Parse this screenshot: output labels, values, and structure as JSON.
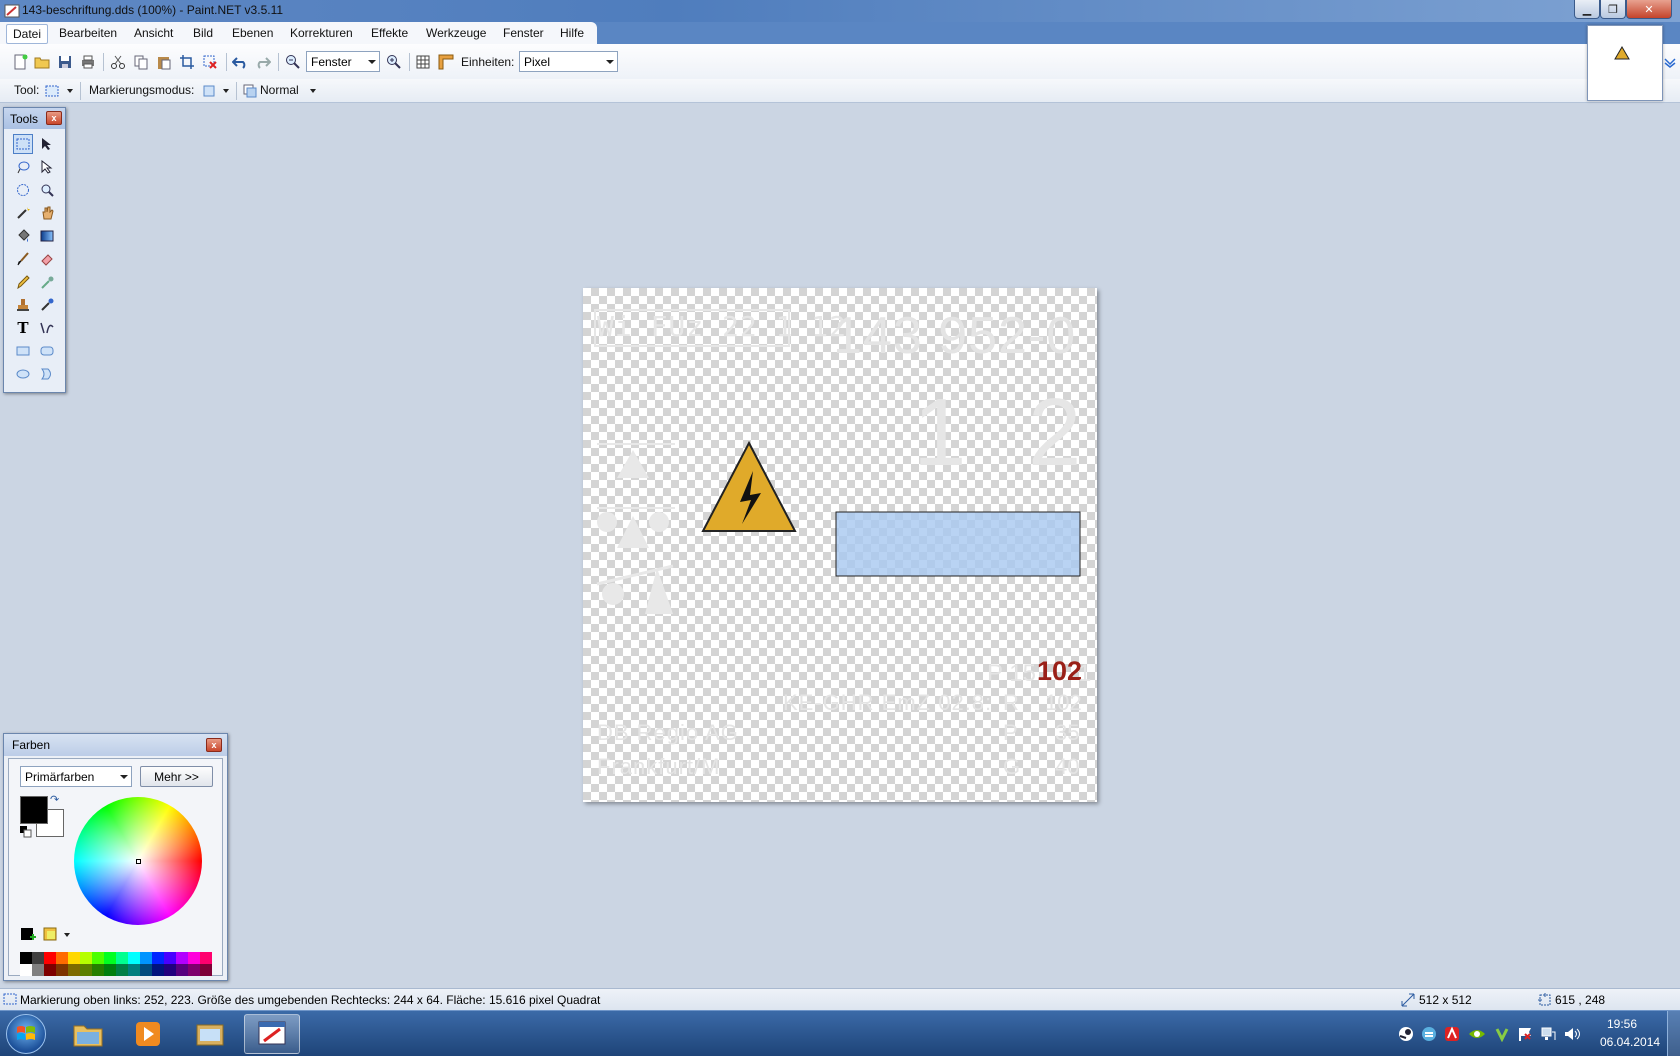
{
  "window": {
    "title": "143-beschriftung.dds (100%) - Paint.NET v3.5.11",
    "buttons": {
      "minimize": "▁",
      "maximize": "❐",
      "close": "✕"
    }
  },
  "menu": {
    "items": [
      "Datei",
      "Bearbeiten",
      "Ansicht",
      "Bild",
      "Ebenen",
      "Korrekturen",
      "Effekte",
      "Werkzeuge",
      "Fenster",
      "Hilfe"
    ]
  },
  "toolbar": {
    "zoom_value": "Fenster",
    "units_label": "Einheiten:",
    "units_value": "Pixel"
  },
  "toolbar2": {
    "tool_label": "Tool:",
    "selection_mode_label": "Markierungsmodus:",
    "blend_mode": "Normal"
  },
  "tools_window": {
    "title": "Tools",
    "close": "x"
  },
  "colors_window": {
    "title": "Farben",
    "close": "x",
    "palette_select": "Primärfarben",
    "more_button": "Mehr >>",
    "primary_color": "#000000",
    "secondary_color": "#ffffff",
    "palette_colors": [
      "#000000",
      "#404040",
      "#ff0000",
      "#ff6a00",
      "#ffd800",
      "#b6ff00",
      "#4cff00",
      "#00ff21",
      "#00ff90",
      "#00ffff",
      "#0094ff",
      "#0026ff",
      "#4800ff",
      "#b200ff",
      "#ff00dc",
      "#ff006e"
    ],
    "palette_colors_dark": [
      "#ffffff",
      "#808080",
      "#7f0000",
      "#7f3300",
      "#7f6a00",
      "#5b7f00",
      "#267f00",
      "#007f0e",
      "#007f46",
      "#007f7f",
      "#004a7f",
      "#00137f",
      "#21007f",
      "#57007f",
      "#7f006e",
      "#7f0037"
    ]
  },
  "canvas": {
    "texts": {
      "box_label": "Wi FUz 22 1 12",
      "big_number": "143 952-0",
      "num_one": "1",
      "num_two": "2",
      "prefix_gy": "P 15",
      "highlight": "102",
      "suffix_1": "1",
      "line_ke": "KE-GHR EmZ 02.8:",
      "r_col": "R",
      "r_val": "102",
      "db_regio": "DB Regio AG",
      "p_col": "P",
      "p_val": "35",
      "frankfurt": "Frankfurt/M",
      "g_col": "G",
      "g_val": "40"
    },
    "colors": {
      "warning_yellow": "#e0aa2a",
      "highlight_red": "#9a2018",
      "selection_blue": "#a8c8f0"
    }
  },
  "statusbar": {
    "selection_info": "Markierung oben links: 252, 223. Größe des umgebenden Rechtecks: 244 x 64. Fläche: 15.616 pixel Quadrat",
    "image_size": "512 x 512",
    "cursor_pos": "615 , 248"
  },
  "taskbar": {
    "time": "19:56",
    "date": "06.04.2014"
  }
}
